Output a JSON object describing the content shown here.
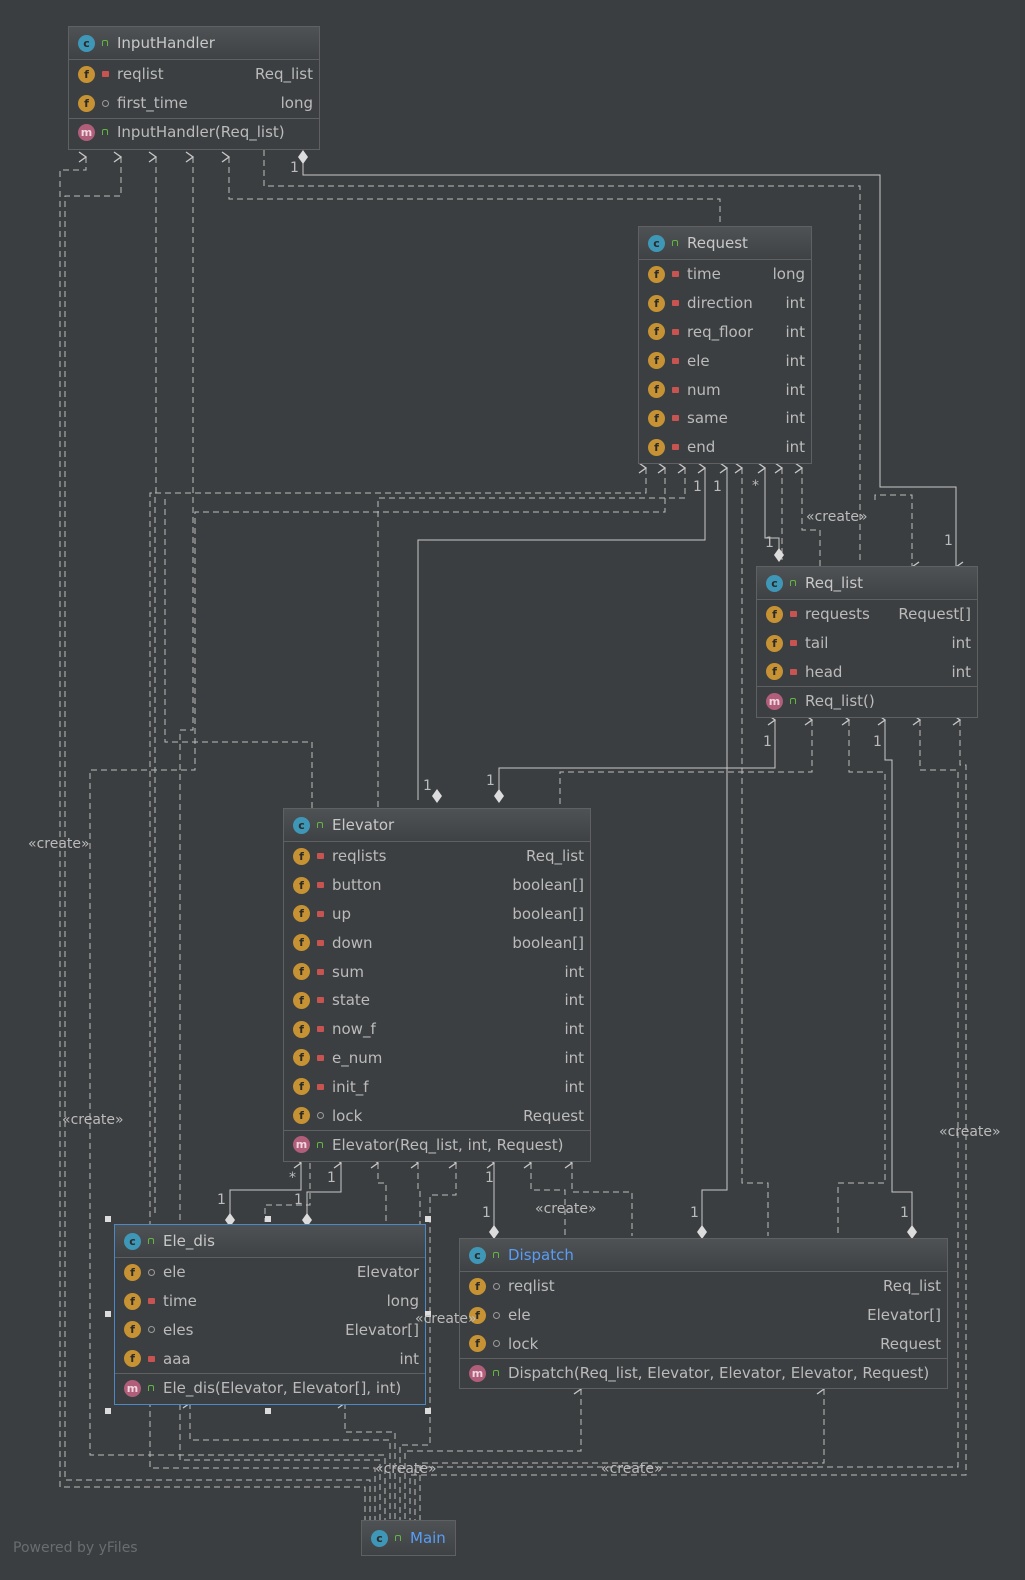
{
  "classes": {
    "inputhandler": {
      "name": "InputHandler",
      "fields": [
        {
          "name": "reqlist",
          "type": "Req_list",
          "vis": "priv"
        },
        {
          "name": "first_time",
          "type": "long",
          "vis": "pkg"
        }
      ],
      "methods": [
        {
          "sig": "InputHandler(Req_list)",
          "vis": "pub"
        }
      ]
    },
    "request": {
      "name": "Request",
      "fields": [
        {
          "name": "time",
          "type": "long",
          "vis": "priv"
        },
        {
          "name": "direction",
          "type": "int",
          "vis": "priv"
        },
        {
          "name": "req_floor",
          "type": "int",
          "vis": "priv"
        },
        {
          "name": "ele",
          "type": "int",
          "vis": "priv"
        },
        {
          "name": "num",
          "type": "int",
          "vis": "priv"
        },
        {
          "name": "same",
          "type": "int",
          "vis": "priv"
        },
        {
          "name": "end",
          "type": "int",
          "vis": "priv"
        }
      ],
      "methods": []
    },
    "req_list": {
      "name": "Req_list",
      "fields": [
        {
          "name": "requests",
          "type": "Request[]",
          "vis": "priv"
        },
        {
          "name": "tail",
          "type": "int",
          "vis": "priv"
        },
        {
          "name": "head",
          "type": "int",
          "vis": "priv"
        }
      ],
      "methods": [
        {
          "sig": "Req_list()",
          "vis": "pub"
        }
      ]
    },
    "elevator": {
      "name": "Elevator",
      "fields": [
        {
          "name": "reqlists",
          "type": "Req_list",
          "vis": "priv"
        },
        {
          "name": "button",
          "type": "boolean[]",
          "vis": "priv"
        },
        {
          "name": "up",
          "type": "boolean[]",
          "vis": "priv"
        },
        {
          "name": "down",
          "type": "boolean[]",
          "vis": "priv"
        },
        {
          "name": "sum",
          "type": "int",
          "vis": "priv"
        },
        {
          "name": "state",
          "type": "int",
          "vis": "priv"
        },
        {
          "name": "now_f",
          "type": "int",
          "vis": "priv"
        },
        {
          "name": "e_num",
          "type": "int",
          "vis": "priv"
        },
        {
          "name": "init_f",
          "type": "int",
          "vis": "priv"
        },
        {
          "name": "lock",
          "type": "Request",
          "vis": "pkg"
        }
      ],
      "methods": [
        {
          "sig": "Elevator(Req_list, int, Request)",
          "vis": "pub"
        }
      ]
    },
    "ele_dis": {
      "name": "Ele_dis",
      "fields": [
        {
          "name": "ele",
          "type": "Elevator",
          "vis": "pkg"
        },
        {
          "name": "time",
          "type": "long",
          "vis": "priv"
        },
        {
          "name": "eles",
          "type": "Elevator[]",
          "vis": "pkg"
        },
        {
          "name": "aaa",
          "type": "int",
          "vis": "priv"
        }
      ],
      "methods": [
        {
          "sig": "Ele_dis(Elevator, Elevator[], int)",
          "vis": "pub"
        }
      ]
    },
    "dispatch": {
      "name": "Dispatch",
      "fields": [
        {
          "name": "reqlist",
          "type": "Req_list",
          "vis": "pkg"
        },
        {
          "name": "ele",
          "type": "Elevator[]",
          "vis": "pkg"
        },
        {
          "name": "lock",
          "type": "Request",
          "vis": "pkg"
        }
      ],
      "methods": [
        {
          "sig": "Dispatch(Req_list, Elevator, Elevator, Elevator, Request)",
          "vis": "pub"
        }
      ]
    },
    "main": {
      "name": "Main",
      "fields": [],
      "methods": []
    }
  },
  "labels": {
    "create": "«create»",
    "one": "1",
    "many": "*"
  },
  "badges": {
    "class": "c",
    "field": "f",
    "method": "m"
  },
  "footer": "Powered by yFiles"
}
